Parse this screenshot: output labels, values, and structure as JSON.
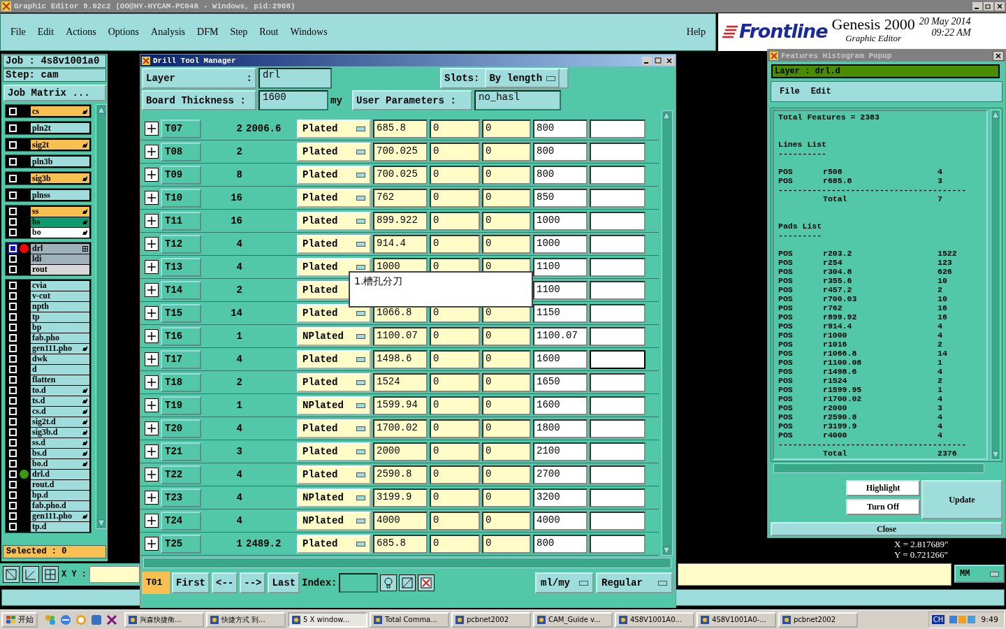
{
  "title_bar": {
    "title": "Graphic Editor 9.02c2 (OO@HY-HYCAM-PC048 - Windows, pid:2908)"
  },
  "menu": [
    "File",
    "Edit",
    "Actions",
    "Options",
    "Analysis",
    "DFM",
    "Step",
    "Rout",
    "Windows"
  ],
  "help": "Help",
  "brand": {
    "logo": "Frontline",
    "product": "Genesis 2000",
    "subtitle": "Graphic Editor",
    "date": "20 May 2014",
    "time": "09:22 AM"
  },
  "job_panel": {
    "job": "Job : 4s8v1001a0",
    "step": "Step: cam",
    "matrix_button": "Job Matrix ...",
    "selected_count": "Selected : 0",
    "layer_groups": [
      [
        {
          "name": "cs",
          "color": "#f8c050",
          "editable": true,
          "selected": false
        }
      ],
      [
        {
          "name": "pln2t",
          "color": "#9fdcdc",
          "editable": false,
          "selected": false
        }
      ],
      [
        {
          "name": "sig2t",
          "color": "#f8c050",
          "editable": true,
          "selected": false
        }
      ],
      [
        {
          "name": "pln3b",
          "color": "#9fdcdc",
          "editable": false,
          "selected": false
        }
      ],
      [
        {
          "name": "sig3b",
          "color": "#f8c050",
          "editable": true,
          "selected": false
        }
      ],
      [
        {
          "name": "plnss",
          "color": "#9fdcdc",
          "editable": false,
          "selected": false
        }
      ],
      [
        {
          "name": "ss",
          "color": "#f8c050",
          "editable": true,
          "selected": false
        },
        {
          "name": "bs",
          "color": "#109a70",
          "editable": true,
          "selected": false
        },
        {
          "name": "bo",
          "color": "#ffffff",
          "editable": true,
          "selected": false
        }
      ],
      [
        {
          "name": "drl",
          "color": "#9fb2bc",
          "editable": false,
          "selected": true,
          "dot": {
            "color": "#ff0000"
          },
          "expandable": true
        },
        {
          "name": "ldi",
          "color": "#9fb2bc",
          "editable": false,
          "selected": false
        },
        {
          "name": "rout",
          "color": "#d8d8d8",
          "editable": false,
          "selected": false
        }
      ],
      [
        {
          "name": "cvia",
          "color": "#9fdcdc",
          "editable": false,
          "selected": false
        },
        {
          "name": "v-cut",
          "color": "#9fdcdc",
          "editable": false,
          "selected": false
        },
        {
          "name": "npth",
          "color": "#9fdcdc",
          "editable": false,
          "selected": false
        },
        {
          "name": "tp",
          "color": "#9fdcdc",
          "editable": false,
          "selected": false
        },
        {
          "name": "bp",
          "color": "#9fdcdc",
          "editable": false,
          "selected": false
        },
        {
          "name": "fab.pho",
          "color": "#9fdcdc",
          "editable": false,
          "selected": false
        },
        {
          "name": "gen111.pho",
          "color": "#9fdcdc",
          "editable": true,
          "selected": false
        },
        {
          "name": "dwk",
          "color": "#9fdcdc",
          "editable": false,
          "selected": false
        },
        {
          "name": "d",
          "color": "#9fdcdc",
          "editable": false,
          "selected": false
        },
        {
          "name": "flatten",
          "color": "#9fdcdc",
          "editable": false,
          "selected": false
        },
        {
          "name": "to.d",
          "color": "#9fdcdc",
          "editable": true,
          "selected": false
        },
        {
          "name": "ts.d",
          "color": "#9fdcdc",
          "editable": true,
          "selected": false
        },
        {
          "name": "cs.d",
          "color": "#9fdcdc",
          "editable": true,
          "selected": false
        },
        {
          "name": "sig2t.d",
          "color": "#9fdcdc",
          "editable": true,
          "selected": false
        },
        {
          "name": "sig3b.d",
          "color": "#9fdcdc",
          "editable": true,
          "selected": false
        },
        {
          "name": "ss.d",
          "color": "#9fdcdc",
          "editable": true,
          "selected": false
        },
        {
          "name": "bs.d",
          "color": "#9fdcdc",
          "editable": true,
          "selected": false
        },
        {
          "name": "bo.d",
          "color": "#9fdcdc",
          "editable": true,
          "selected": false
        },
        {
          "name": "drl.d",
          "color": "#9fdcdc",
          "editable": false,
          "selected": false,
          "dot": {
            "color": "#3c9a10"
          }
        },
        {
          "name": "rout.d",
          "color": "#9fdcdc",
          "editable": false,
          "selected": false
        },
        {
          "name": "bp.d",
          "color": "#9fdcdc",
          "editable": false,
          "selected": false
        },
        {
          "name": "fab.pho.d",
          "color": "#9fdcdc",
          "editable": false,
          "selected": false
        },
        {
          "name": "gen111.pho",
          "color": "#9fdcdc",
          "editable": true,
          "selected": false
        },
        {
          "name": "tp.d",
          "color": "#9fdcdc",
          "editable": false,
          "selected": false
        }
      ]
    ]
  },
  "drill_tool": {
    "title": "Drill Tool Manager",
    "layer_label": "Layer",
    "layer_colon": ":",
    "layer": "drl",
    "slots_label": "Slots:",
    "slots": "By length",
    "thickness_label": "Board Thickness :",
    "thickness": "1600",
    "thickness_unit": "my",
    "user_params_label": "User Parameters :",
    "user_params": "no_hasl",
    "rows": [
      {
        "tool": "T07",
        "column_3": "2",
        "column_4": "2006.6",
        "column_5": "Plated",
        "column_6": "685.8",
        "column_7": "0",
        "column_8": "0",
        "column_9": "800",
        "focused": false
      },
      {
        "tool": "T08",
        "column_3": "2",
        "column_5": "Plated",
        "column_6": "700.025",
        "column_7": "0",
        "column_8": "0",
        "column_9": "800",
        "focused": false
      },
      {
        "tool": "T09",
        "column_3": "8",
        "column_5": "Plated",
        "column_6": "700.025",
        "column_7": "0",
        "column_8": "0",
        "column_9": "800",
        "focused": false
      },
      {
        "tool": "T10",
        "column_3": "16",
        "column_5": "Plated",
        "column_6": "762",
        "column_7": "0",
        "column_8": "0",
        "column_9": "850",
        "focused": false
      },
      {
        "tool": "T11",
        "column_3": "16",
        "column_5": "Plated",
        "column_6": "899.922",
        "column_7": "0",
        "column_8": "0",
        "column_9": "1000",
        "focused": false
      },
      {
        "tool": "T12",
        "column_3": "4",
        "column_5": "Plated",
        "column_6": "914.4",
        "column_7": "0",
        "column_8": "0",
        "column_9": "1000",
        "focused": false
      },
      {
        "tool": "T13",
        "column_3": "4",
        "column_5": "Plated",
        "column_6": "1000",
        "column_7": "0",
        "column_8": "0",
        "column_9": "1100",
        "focused": false
      },
      {
        "tool": "T14",
        "column_3": "2",
        "column_5": "Plated",
        "column_9": "1100",
        "focused": false
      },
      {
        "tool": "T15",
        "column_3": "14",
        "column_5": "Plated",
        "column_6": "1066.8",
        "column_7": "0",
        "column_8": "0",
        "column_9": "1150",
        "focused": false
      },
      {
        "tool": "T16",
        "column_3": "1",
        "column_5": "NPlated",
        "column_6": "1100.07",
        "column_7": "0",
        "column_8": "0",
        "column_9": "1100.07",
        "focused": false
      },
      {
        "tool": "T17",
        "column_3": "4",
        "column_5": "Plated",
        "column_6": "1498.6",
        "column_7": "0",
        "column_8": "0",
        "column_9": "1600",
        "focused": true
      },
      {
        "tool": "T18",
        "column_3": "2",
        "column_5": "Plated",
        "column_6": "1524",
        "column_7": "0",
        "column_8": "0",
        "column_9": "1650",
        "focused": false
      },
      {
        "tool": "T19",
        "column_3": "1",
        "column_5": "NPlated",
        "column_6": "1599.94",
        "column_7": "0",
        "column_8": "0",
        "column_9": "1600",
        "focused": false
      },
      {
        "tool": "T20",
        "column_3": "4",
        "column_5": "Plated",
        "column_6": "1700.02",
        "column_7": "0",
        "column_8": "0",
        "column_9": "1800",
        "focused": false
      },
      {
        "tool": "T21",
        "column_3": "3",
        "column_5": "Plated",
        "column_6": "2000",
        "column_7": "0",
        "column_8": "0",
        "column_9": "2100",
        "focused": false
      },
      {
        "tool": "T22",
        "column_3": "4",
        "column_5": "Plated",
        "column_6": "2590.8",
        "column_7": "0",
        "column_8": "0",
        "column_9": "2700",
        "focused": false
      },
      {
        "tool": "T23",
        "column_3": "4",
        "column_5": "NPlated",
        "column_6": "3199.9",
        "column_7": "0",
        "column_8": "0",
        "column_9": "3200",
        "focused": false
      },
      {
        "tool": "T24",
        "column_3": "4",
        "column_5": "NPlated",
        "column_6": "4000",
        "column_7": "0",
        "column_8": "0",
        "column_9": "4000",
        "focused": false
      },
      {
        "tool": "T25",
        "column_3": "1",
        "column_4": "2489.2",
        "column_5": "Plated",
        "column_6": "685.8",
        "column_7": "0",
        "column_8": "0",
        "column_9": "800",
        "focused": false
      }
    ],
    "tooltip": "1.槽孔分刀",
    "current_tool": "T01",
    "nav_buttons": [
      "First",
      "<--",
      "-->",
      "Last"
    ],
    "index_label": "Index:",
    "units": "ml/my",
    "mode": "Regular"
  },
  "histogram": {
    "title": "Features Histogram Popup",
    "layer": "Layer :  drl.d",
    "menu": [
      "File",
      "Edit"
    ],
    "total_features": "Total Features = 2383",
    "sections": [
      {
        "title": "Lines List",
        "underline": "----------",
        "rows": [
          {
            "polarity": "POS",
            "symbol": "r508",
            "count": "4"
          },
          {
            "polarity": "POS",
            "symbol": "r685.8",
            "count": "3"
          }
        ],
        "rule": "---------------------------------------",
        "total_label": "Total",
        "total": "7"
      },
      {
        "title": "Pads List",
        "underline": "---------",
        "rows": [
          {
            "polarity": "POS",
            "symbol": "r203.2",
            "count": "1522"
          },
          {
            "polarity": "POS",
            "symbol": "r254",
            "count": "123"
          },
          {
            "polarity": "POS",
            "symbol": "r304.8",
            "count": "626"
          },
          {
            "polarity": "POS",
            "symbol": "r355.6",
            "count": "10"
          },
          {
            "polarity": "POS",
            "symbol": "r457.2",
            "count": "2"
          },
          {
            "polarity": "POS",
            "symbol": "r700.03",
            "count": "10"
          },
          {
            "polarity": "POS",
            "symbol": "r762",
            "count": "16"
          },
          {
            "polarity": "POS",
            "symbol": "r899.92",
            "count": "16"
          },
          {
            "polarity": "POS",
            "symbol": "r914.4",
            "count": "4"
          },
          {
            "polarity": "POS",
            "symbol": "r1000",
            "count": "4"
          },
          {
            "polarity": "POS",
            "symbol": "r1016",
            "count": "2"
          },
          {
            "polarity": "POS",
            "symbol": "r1066.8",
            "count": "14"
          },
          {
            "polarity": "POS",
            "symbol": "r1100.08",
            "count": "1"
          },
          {
            "polarity": "POS",
            "symbol": "r1498.6",
            "count": "4"
          },
          {
            "polarity": "POS",
            "symbol": "r1524",
            "count": "2"
          },
          {
            "polarity": "POS",
            "symbol": "r1599.95",
            "count": "1"
          },
          {
            "polarity": "POS",
            "symbol": "r1700.02",
            "count": "4"
          },
          {
            "polarity": "POS",
            "symbol": "r2000",
            "count": "3"
          },
          {
            "polarity": "POS",
            "symbol": "r2590.8",
            "count": "4"
          },
          {
            "polarity": "POS",
            "symbol": "r3199.9",
            "count": "4"
          },
          {
            "polarity": "POS",
            "symbol": "r4000",
            "count": "4"
          }
        ],
        "rule": "---------------------------------------",
        "total_label": "Total",
        "total": "2376"
      }
    ],
    "buttons": {
      "highlight": "Highlight",
      "turn_off": "Turn Off",
      "update": "Update",
      "close": "Close"
    }
  },
  "status": {
    "xy_label": "X Y :",
    "units": "MM",
    "coords": [
      "X = 2.817689\"",
      "Y = 0.721266\""
    ]
  },
  "taskbar": {
    "start": "开始",
    "tasks": [
      {
        "label": "兴森快捷衡...",
        "selected": false
      },
      {
        "label": "快捷方式 到...",
        "selected": false
      },
      {
        "label": "5 X window...",
        "selected": true
      },
      {
        "label": "Total Comma...",
        "selected": false
      },
      {
        "label": "pcbnet2002",
        "selected": false
      },
      {
        "label": "CAM_Guide v...",
        "selected": false
      },
      {
        "label": "4S8V1001A0...",
        "selected": false
      },
      {
        "label": "4S8V1001A0-...",
        "selected": false
      },
      {
        "label": "pcbnet2002",
        "selected": false
      }
    ],
    "language": "CH",
    "time": "9:49"
  }
}
